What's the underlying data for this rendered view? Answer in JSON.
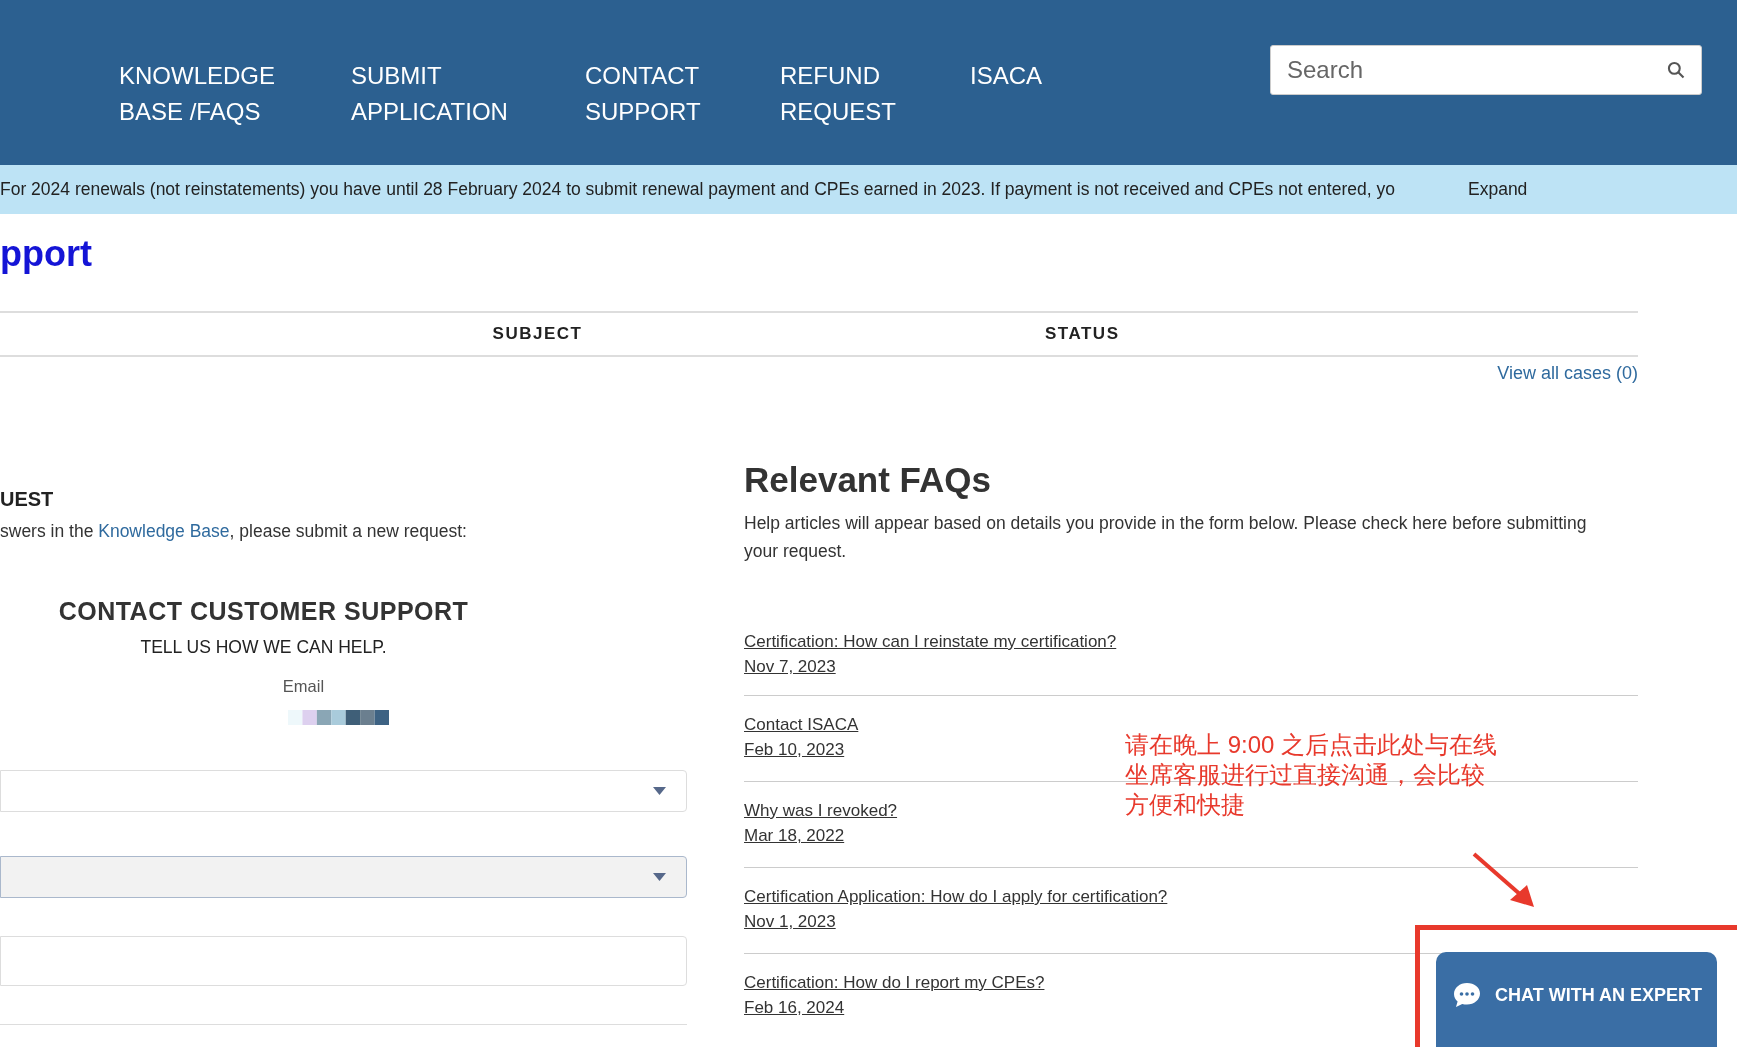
{
  "nav": {
    "items": [
      {
        "lines": [
          "KNOWLEDGE",
          "BASE /FAQS"
        ]
      },
      {
        "lines": [
          "SUBMIT",
          "APPLICATION"
        ]
      },
      {
        "lines": [
          "CONTACT",
          "SUPPORT"
        ]
      },
      {
        "lines": [
          "REFUND",
          "REQUEST"
        ]
      },
      {
        "lines": [
          "ISACA"
        ]
      }
    ],
    "search": {
      "placeholder": "Search"
    }
  },
  "banner": {
    "text": "For 2024 renewals (not reinstatements) you have until 28 February 2024 to submit renewal payment and CPEs earned in 2023. If payment is not received and CPEs not entered, yo",
    "action": "Expand"
  },
  "page_title": "pport",
  "cases_table": {
    "columns": [
      "SUBJECT",
      "STATUS"
    ],
    "link": "View all cases (0)"
  },
  "request": {
    "heading": "UEST",
    "intro_before": "swers in the ",
    "intro_link": "Knowledge Base",
    "intro_after": ", please submit a new request:",
    "form": {
      "title": "CONTACT CUSTOMER SUPPORT",
      "subtitle": "TELL US HOW WE CAN HELP.",
      "email_label": "Email",
      "fields": [
        {
          "kind": "select",
          "disabled": false
        },
        {
          "kind": "select",
          "disabled": true
        },
        {
          "kind": "text",
          "disabled": false
        }
      ]
    }
  },
  "faqs": {
    "title": "Relevant FAQs",
    "description": "Help articles will appear based on details you provide in the form below. Please check here before submitting your request.",
    "items": [
      {
        "title": "Certification: How can I reinstate my certification?",
        "date": "Nov 7, 2023"
      },
      {
        "title": "Contact ISACA",
        "date": "Feb 10, 2023"
      },
      {
        "title": "Why was I revoked?",
        "date": "Mar 18, 2022"
      },
      {
        "title": "Certification Application: How do I apply for certification?",
        "date": "Nov 1, 2023"
      },
      {
        "title": "Certification: How do I report my CPEs?",
        "date": "Feb 16, 2024"
      }
    ]
  },
  "annotation": {
    "lines": [
      "请在晚上 9:00 之后点击此处与在线",
      "坐席客服进行过直接沟通，会比较",
      "方便和快捷"
    ]
  },
  "chat_button": {
    "label": "CHAT WITH AN EXPERT"
  }
}
